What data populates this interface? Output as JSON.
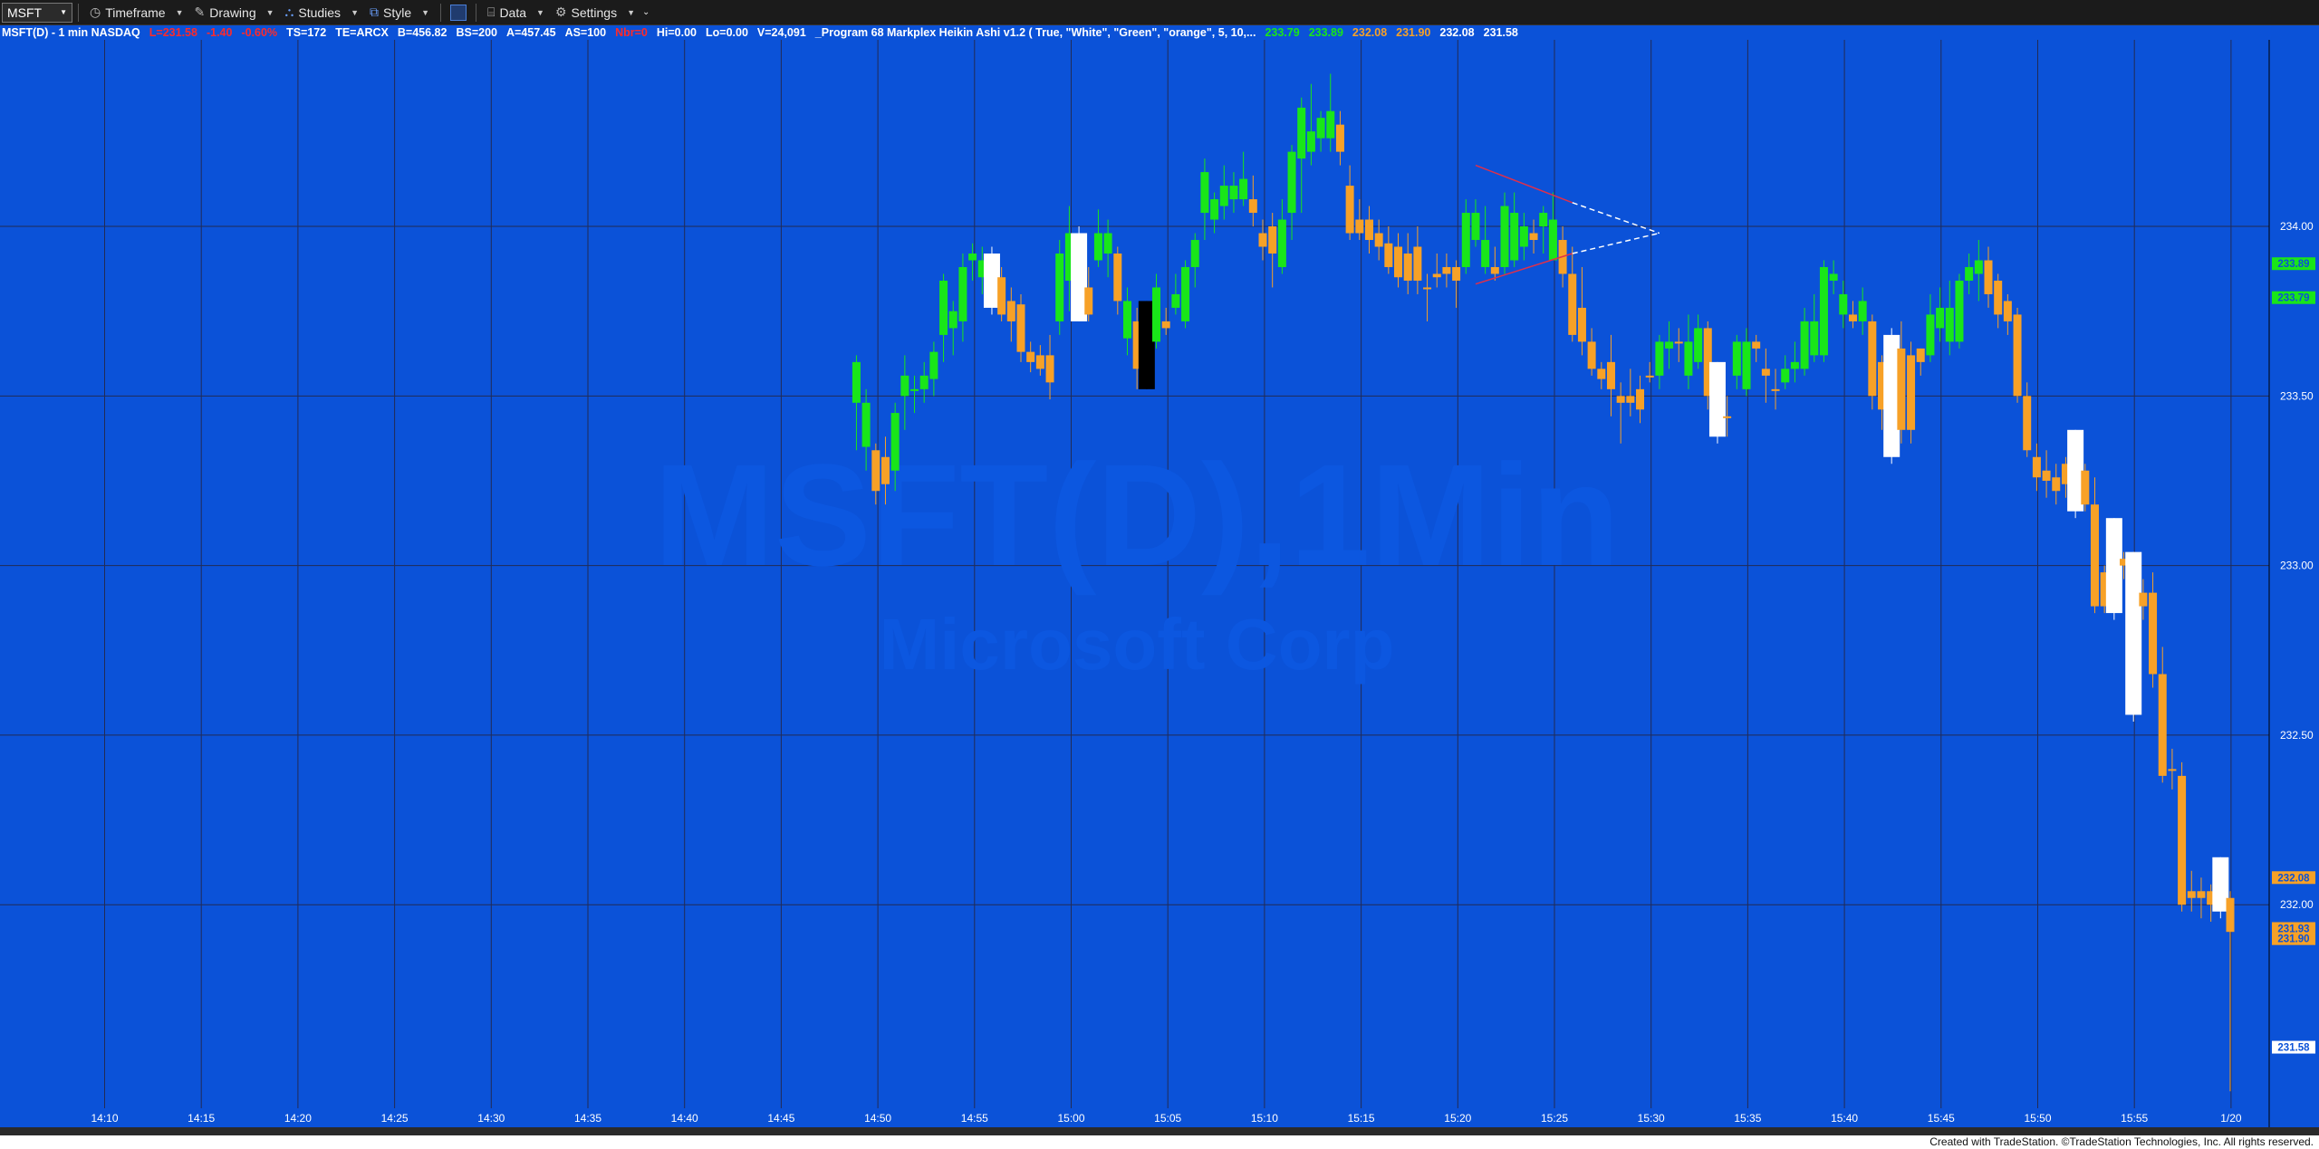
{
  "toolbar": {
    "symbol": "MSFT",
    "timeframe_label": "Timeframe",
    "drawing_label": "Drawing",
    "studies_label": "Studies",
    "style_label": "Style",
    "data_label": "Data",
    "settings_label": "Settings"
  },
  "infobar": {
    "symbol_desc": "MSFT(D) - 1 min  NASDAQ",
    "last": "L=231.58",
    "change": "-1.40",
    "pct": "-0.60%",
    "ts": "TS=172",
    "te": "TE=ARCX",
    "bid": "B=456.82",
    "bs": "BS=200",
    "ask": "A=457.45",
    "as": "AS=100",
    "red_tag": "Nbr=0",
    "hi": "Hi=0.00",
    "lo": "Lo=0.00",
    "vol": "V=24,091",
    "study": "_Program 68 Markplex Heikin Ashi v1.2 ( True, \"White\", \"Green\", \"orange\", 5, 10,...",
    "vals": [
      "233.79",
      "233.89",
      "232.08",
      "231.90",
      "232.08",
      "231.58"
    ]
  },
  "watermark": {
    "line1": "MSFT(D),1Min",
    "line2": "Microsoft Corp"
  },
  "footer": "Created with TradeStation. ©TradeStation Technologies, Inc. All rights reserved.",
  "colors": {
    "background": "#0b52d8",
    "up": "#19e619",
    "down": "#f7a127",
    "white": "#ffffff",
    "black": "#000000",
    "grid": "#222b55"
  },
  "chart_data": {
    "type": "candlestick",
    "ylim": [
      231.4,
      234.55
    ],
    "y_ticks": [
      "234.00",
      "233.50",
      "233.00",
      "232.50",
      "232.00"
    ],
    "x_ticks": [
      "14:10",
      "14:15",
      "14:20",
      "14:25",
      "14:30",
      "14:35",
      "14:40",
      "14:45",
      "14:50",
      "14:55",
      "15:00",
      "15:05",
      "15:10",
      "15:15",
      "15:20",
      "15:25",
      "15:30",
      "15:35",
      "15:40",
      "15:45",
      "15:50",
      "15:55",
      "1/20"
    ],
    "price_markers": [
      {
        "label": "233.89",
        "value": 233.89,
        "color": "green"
      },
      {
        "label": "233.79",
        "value": 233.79,
        "color": "green"
      },
      {
        "label": "232.08",
        "value": 232.08,
        "color": "orange"
      },
      {
        "label": "231.93",
        "value": 231.93,
        "color": "orange"
      },
      {
        "label": "231.90",
        "value": 231.9,
        "color": "orange"
      },
      {
        "label": "231.58",
        "value": 231.58,
        "color": "white"
      }
    ],
    "candles": [
      [
        233.48,
        233.6,
        233.34,
        233.62,
        "g"
      ],
      [
        233.35,
        233.48,
        233.28,
        233.52,
        "g"
      ],
      [
        233.22,
        233.34,
        233.18,
        233.36,
        "o"
      ],
      [
        233.24,
        233.32,
        233.18,
        233.38,
        "o"
      ],
      [
        233.28,
        233.45,
        233.22,
        233.48,
        "g"
      ],
      [
        233.5,
        233.56,
        233.4,
        233.62,
        "g"
      ],
      [
        233.52,
        233.52,
        233.45,
        233.56,
        "g"
      ],
      [
        233.52,
        233.56,
        233.48,
        233.6,
        "g"
      ],
      [
        233.55,
        233.63,
        233.5,
        233.66,
        "g"
      ],
      [
        233.68,
        233.84,
        233.6,
        233.86,
        "g"
      ],
      [
        233.7,
        233.75,
        233.62,
        233.78,
        "g"
      ],
      [
        233.72,
        233.88,
        233.66,
        233.92,
        "g"
      ],
      [
        233.9,
        233.92,
        233.84,
        233.95,
        "g"
      ],
      [
        233.85,
        233.9,
        233.8,
        233.94,
        "g"
      ],
      [
        233.76,
        233.92,
        233.74,
        233.94,
        "w"
      ],
      [
        233.85,
        233.74,
        233.72,
        233.88,
        "o"
      ],
      [
        233.78,
        233.72,
        233.66,
        233.82,
        "o"
      ],
      [
        233.77,
        233.63,
        233.6,
        233.8,
        "o"
      ],
      [
        233.63,
        233.6,
        233.57,
        233.66,
        "o"
      ],
      [
        233.62,
        233.58,
        233.56,
        233.65,
        "o"
      ],
      [
        233.62,
        233.54,
        233.49,
        233.68,
        "o"
      ],
      [
        233.72,
        233.92,
        233.68,
        233.96,
        "g"
      ],
      [
        233.84,
        233.98,
        233.75,
        234.06,
        "g"
      ],
      [
        233.72,
        233.98,
        233.72,
        234.0,
        "w"
      ],
      [
        233.74,
        233.82,
        233.72,
        233.88,
        "o"
      ],
      [
        233.9,
        233.98,
        233.88,
        234.05,
        "g"
      ],
      [
        233.92,
        233.98,
        233.85,
        234.02,
        "g"
      ],
      [
        233.92,
        233.78,
        233.74,
        233.94,
        "o"
      ],
      [
        233.67,
        233.78,
        233.62,
        233.82,
        "g"
      ],
      [
        233.58,
        233.72,
        233.52,
        233.76,
        "o"
      ],
      [
        233.52,
        233.78,
        233.52,
        233.78,
        "k"
      ],
      [
        233.66,
        233.82,
        233.64,
        233.86,
        "g"
      ],
      [
        233.72,
        233.7,
        233.68,
        233.76,
        "o"
      ],
      [
        233.76,
        233.8,
        233.74,
        233.86,
        "g"
      ],
      [
        233.72,
        233.88,
        233.7,
        233.9,
        "g"
      ],
      [
        233.88,
        233.96,
        233.82,
        233.98,
        "g"
      ],
      [
        234.04,
        234.16,
        233.96,
        234.2,
        "g"
      ],
      [
        234.02,
        234.08,
        233.98,
        234.1,
        "g"
      ],
      [
        234.06,
        234.12,
        234.02,
        234.18,
        "g"
      ],
      [
        234.08,
        234.12,
        234.04,
        234.16,
        "g"
      ],
      [
        234.14,
        234.08,
        234.06,
        234.22,
        "g"
      ],
      [
        234.08,
        234.04,
        234.0,
        234.15,
        "o"
      ],
      [
        233.98,
        233.94,
        233.9,
        234.02,
        "o"
      ],
      [
        234.0,
        233.92,
        233.82,
        234.04,
        "o"
      ],
      [
        233.88,
        234.02,
        233.86,
        234.08,
        "g"
      ],
      [
        234.04,
        234.22,
        233.96,
        234.24,
        "g"
      ],
      [
        234.2,
        234.35,
        234.04,
        234.38,
        "g"
      ],
      [
        234.28,
        234.22,
        234.18,
        234.42,
        "g"
      ],
      [
        234.26,
        234.32,
        234.22,
        234.34,
        "g"
      ],
      [
        234.26,
        234.34,
        234.22,
        234.45,
        "g"
      ],
      [
        234.3,
        234.22,
        234.18,
        234.34,
        "o"
      ],
      [
        234.12,
        233.98,
        233.96,
        234.18,
        "o"
      ],
      [
        234.02,
        233.98,
        233.96,
        234.08,
        "o"
      ],
      [
        234.02,
        233.96,
        233.92,
        234.06,
        "o"
      ],
      [
        233.98,
        233.94,
        233.9,
        234.02,
        "o"
      ],
      [
        233.95,
        233.88,
        233.86,
        234.0,
        "o"
      ],
      [
        233.94,
        233.85,
        233.82,
        233.98,
        "o"
      ],
      [
        233.92,
        233.84,
        233.8,
        233.98,
        "o"
      ],
      [
        233.94,
        233.84,
        233.8,
        234.0,
        "o"
      ],
      [
        233.82,
        233.82,
        233.72,
        233.86,
        "o"
      ],
      [
        233.85,
        233.86,
        233.82,
        233.92,
        "o"
      ],
      [
        233.88,
        233.86,
        233.82,
        233.92,
        "o"
      ],
      [
        233.88,
        233.84,
        233.76,
        233.9,
        "o"
      ],
      [
        233.88,
        234.04,
        233.86,
        234.08,
        "g"
      ],
      [
        233.96,
        234.04,
        233.94,
        234.08,
        "g"
      ],
      [
        233.88,
        233.96,
        233.86,
        234.06,
        "g"
      ],
      [
        233.88,
        233.86,
        233.84,
        233.94,
        "o"
      ],
      [
        233.88,
        234.06,
        233.86,
        234.1,
        "g"
      ],
      [
        233.9,
        234.04,
        233.88,
        234.1,
        "g"
      ],
      [
        233.94,
        234.0,
        233.9,
        234.04,
        "g"
      ],
      [
        233.98,
        233.96,
        233.92,
        234.02,
        "o"
      ],
      [
        234.0,
        234.04,
        233.92,
        234.06,
        "g"
      ],
      [
        234.02,
        233.9,
        233.9,
        234.1,
        "g"
      ],
      [
        233.96,
        233.86,
        233.82,
        234.0,
        "o"
      ],
      [
        233.86,
        233.68,
        233.66,
        233.94,
        "o"
      ],
      [
        233.76,
        233.66,
        233.62,
        233.88,
        "o"
      ],
      [
        233.66,
        233.58,
        233.56,
        233.7,
        "o"
      ],
      [
        233.58,
        233.55,
        233.52,
        233.6,
        "o"
      ],
      [
        233.6,
        233.52,
        233.44,
        233.68,
        "o"
      ],
      [
        233.5,
        233.48,
        233.36,
        233.54,
        "o"
      ],
      [
        233.5,
        233.48,
        233.44,
        233.58,
        "o"
      ],
      [
        233.52,
        233.46,
        233.42,
        233.56,
        "o"
      ],
      [
        233.56,
        233.56,
        233.54,
        233.6,
        "o"
      ],
      [
        233.56,
        233.66,
        233.52,
        233.68,
        "g"
      ],
      [
        233.64,
        233.66,
        233.58,
        233.72,
        "g"
      ],
      [
        233.66,
        233.66,
        233.6,
        233.7,
        "o"
      ],
      [
        233.56,
        233.66,
        233.52,
        233.74,
        "g"
      ],
      [
        233.6,
        233.7,
        233.58,
        233.74,
        "g"
      ],
      [
        233.7,
        233.5,
        233.46,
        233.72,
        "o"
      ],
      [
        233.38,
        233.6,
        233.36,
        233.6,
        "w"
      ],
      [
        233.44,
        233.44,
        233.38,
        233.5,
        "o"
      ],
      [
        233.56,
        233.66,
        233.52,
        233.68,
        "g"
      ],
      [
        233.52,
        233.66,
        233.5,
        233.7,
        "g"
      ],
      [
        233.66,
        233.64,
        233.6,
        233.68,
        "o"
      ],
      [
        233.56,
        233.58,
        233.48,
        233.64,
        "o"
      ],
      [
        233.52,
        233.52,
        233.46,
        233.58,
        "o"
      ],
      [
        233.54,
        233.58,
        233.52,
        233.62,
        "g"
      ],
      [
        233.58,
        233.6,
        233.54,
        233.66,
        "g"
      ],
      [
        233.58,
        233.72,
        233.56,
        233.76,
        "g"
      ],
      [
        233.62,
        233.72,
        233.6,
        233.8,
        "g"
      ],
      [
        233.62,
        233.88,
        233.6,
        233.9,
        "g"
      ],
      [
        233.86,
        233.84,
        233.8,
        233.9,
        "g"
      ],
      [
        233.74,
        233.8,
        233.7,
        233.84,
        "g"
      ],
      [
        233.72,
        233.74,
        233.7,
        233.78,
        "o"
      ],
      [
        233.72,
        233.78,
        233.68,
        233.82,
        "g"
      ],
      [
        233.72,
        233.5,
        233.46,
        233.74,
        "o"
      ],
      [
        233.6,
        233.46,
        233.4,
        233.62,
        "o"
      ],
      [
        233.32,
        233.68,
        233.3,
        233.7,
        "w"
      ],
      [
        233.64,
        233.4,
        233.36,
        233.72,
        "o"
      ],
      [
        233.62,
        233.4,
        233.36,
        233.66,
        "o"
      ],
      [
        233.64,
        233.6,
        233.56,
        233.64,
        "o"
      ],
      [
        233.62,
        233.74,
        233.6,
        233.8,
        "g"
      ],
      [
        233.7,
        233.76,
        233.66,
        233.82,
        "g"
      ],
      [
        233.66,
        233.76,
        233.62,
        233.84,
        "g"
      ],
      [
        233.66,
        233.84,
        233.64,
        233.86,
        "g"
      ],
      [
        233.84,
        233.88,
        233.8,
        233.92,
        "g"
      ],
      [
        233.86,
        233.9,
        233.78,
        233.96,
        "g"
      ],
      [
        233.9,
        233.8,
        233.76,
        233.94,
        "o"
      ],
      [
        233.84,
        233.74,
        233.7,
        233.86,
        "o"
      ],
      [
        233.78,
        233.72,
        233.68,
        233.8,
        "o"
      ],
      [
        233.74,
        233.5,
        233.48,
        233.76,
        "o"
      ],
      [
        233.5,
        233.34,
        233.32,
        233.54,
        "o"
      ],
      [
        233.32,
        233.26,
        233.22,
        233.36,
        "o"
      ],
      [
        233.28,
        233.25,
        233.2,
        233.34,
        "o"
      ],
      [
        233.22,
        233.26,
        233.18,
        233.3,
        "o"
      ],
      [
        233.24,
        233.3,
        233.2,
        233.32,
        "o"
      ],
      [
        233.16,
        233.4,
        233.14,
        233.4,
        "w"
      ],
      [
        233.28,
        233.18,
        233.16,
        233.3,
        "o"
      ],
      [
        233.18,
        232.88,
        232.86,
        233.26,
        "o"
      ],
      [
        232.88,
        232.98,
        232.86,
        233.0,
        "o"
      ],
      [
        232.86,
        233.14,
        232.84,
        233.14,
        "w"
      ],
      [
        233.02,
        233.0,
        232.96,
        233.04,
        "o"
      ],
      [
        232.56,
        233.04,
        232.54,
        233.04,
        "w"
      ],
      [
        232.92,
        232.88,
        232.84,
        232.96,
        "o"
      ],
      [
        232.92,
        232.68,
        232.64,
        232.98,
        "o"
      ],
      [
        232.68,
        232.38,
        232.36,
        232.76,
        "o"
      ],
      [
        232.4,
        232.4,
        232.34,
        232.46,
        "o"
      ],
      [
        232.38,
        232.0,
        231.98,
        232.42,
        "o"
      ],
      [
        232.02,
        232.04,
        231.98,
        232.1,
        "o"
      ],
      [
        232.04,
        232.02,
        231.96,
        232.08,
        "o"
      ],
      [
        232.04,
        232.0,
        231.95,
        232.06,
        "o"
      ],
      [
        231.98,
        232.14,
        231.96,
        232.14,
        "w"
      ],
      [
        232.02,
        231.92,
        231.45,
        232.04,
        "o"
      ]
    ]
  }
}
